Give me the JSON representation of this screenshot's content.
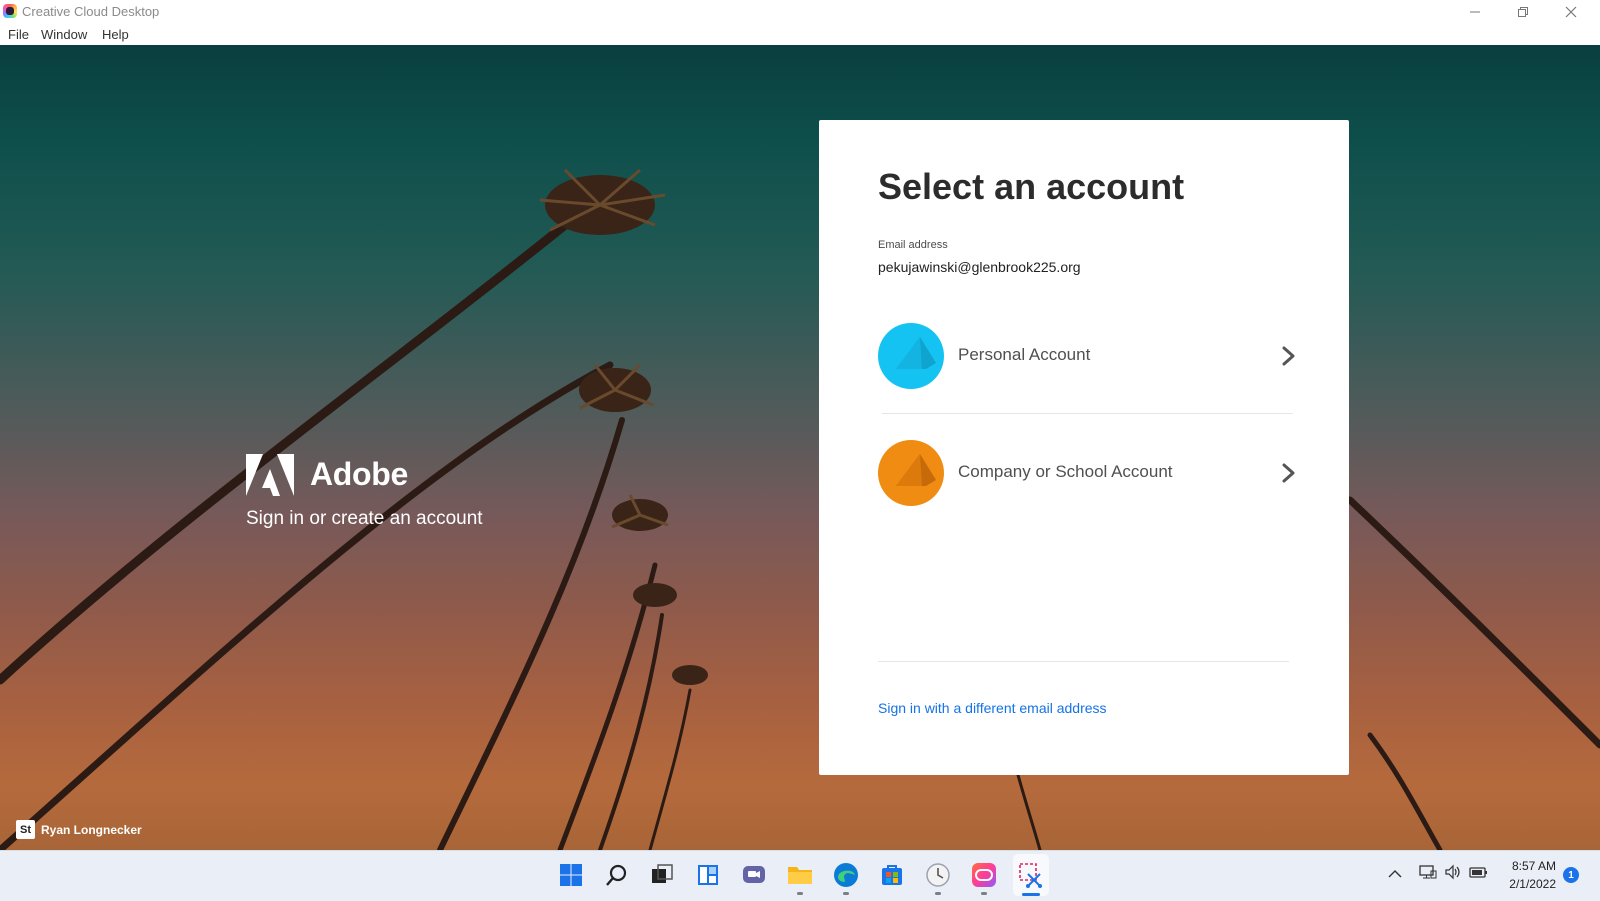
{
  "window": {
    "title": "Creative Cloud Desktop",
    "controls": {
      "minimize": "—",
      "maximize": "❐",
      "close": "✕"
    }
  },
  "menu": {
    "items": [
      "File",
      "Window",
      "Help"
    ]
  },
  "brand": {
    "name": "Adobe",
    "tagline": "Sign in or create an account"
  },
  "photo_credit": {
    "badge": "St",
    "name": "Ryan Longnecker"
  },
  "dialog": {
    "title": "Select an account",
    "email_label": "Email address",
    "email_value": "pekujawinski@glenbrook225.org",
    "accounts": [
      {
        "label": "Personal Account",
        "color": "#14c3f2"
      },
      {
        "label": "Company or School Account",
        "color": "#f18c12"
      }
    ],
    "alt_link": "Sign in with a different email address",
    "link_color": "#1473e6"
  },
  "taskbar": {
    "icons": [
      "windows-start-icon",
      "search-icon",
      "task-view-icon",
      "widgets-icon",
      "chat-icon",
      "file-explorer-icon",
      "edge-icon",
      "store-icon",
      "clock-app-icon",
      "creative-cloud-icon",
      "snipping-tool-icon"
    ],
    "clock": {
      "time": "8:57 AM",
      "date": "2/1/2022"
    },
    "notification_count": "1",
    "tray_chevron": "^"
  }
}
